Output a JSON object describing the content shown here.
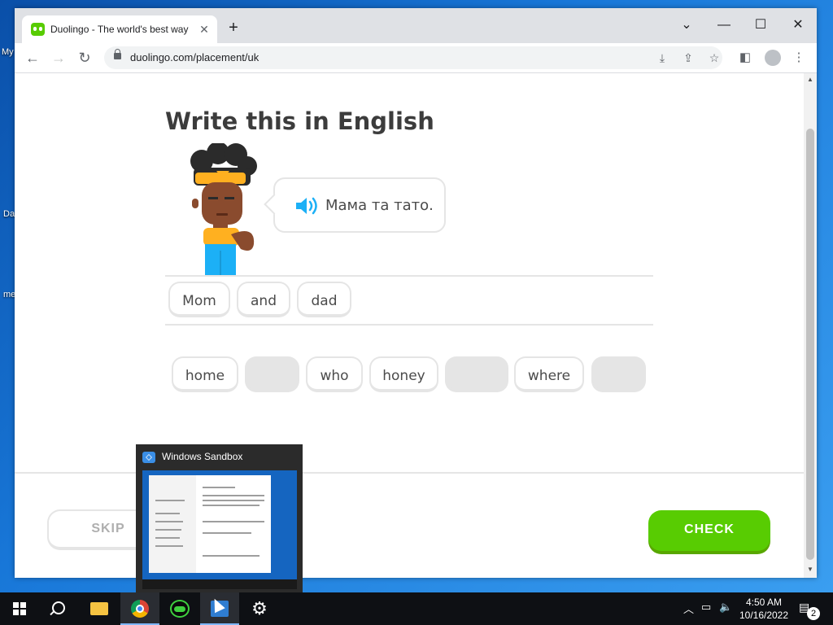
{
  "desktop": {
    "icon_labels": [
      "My",
      "Da",
      "me"
    ]
  },
  "browser": {
    "tab": {
      "title": "Duolingo - The world's best way",
      "close": "✕"
    },
    "new_tab": "+",
    "window_controls": {
      "chevron": "⌄",
      "minimize": "—",
      "maximize": "☐",
      "close": "✕"
    },
    "nav": {
      "back": "←",
      "forward": "→",
      "reload": "↻"
    },
    "url": "duolingo.com/placement/uk"
  },
  "lesson": {
    "heading": "Write this in English",
    "prompt": "Мама та тато.",
    "answer_words": [
      "Mom",
      "and",
      "dad"
    ],
    "word_bank": [
      "home",
      "",
      "who",
      "honey",
      "",
      "where",
      ""
    ],
    "skip_label": "SKIP",
    "check_label": "CHECK"
  },
  "taskbar_preview": {
    "title": "Windows Sandbox"
  },
  "taskbar": {
    "time": "4:50 AM",
    "date": "10/16/2022",
    "notification_count": "2"
  },
  "colors": {
    "accent_green": "#58cc02",
    "chip_border": "#e5e5e5",
    "speaker_blue": "#1cb0f6"
  }
}
